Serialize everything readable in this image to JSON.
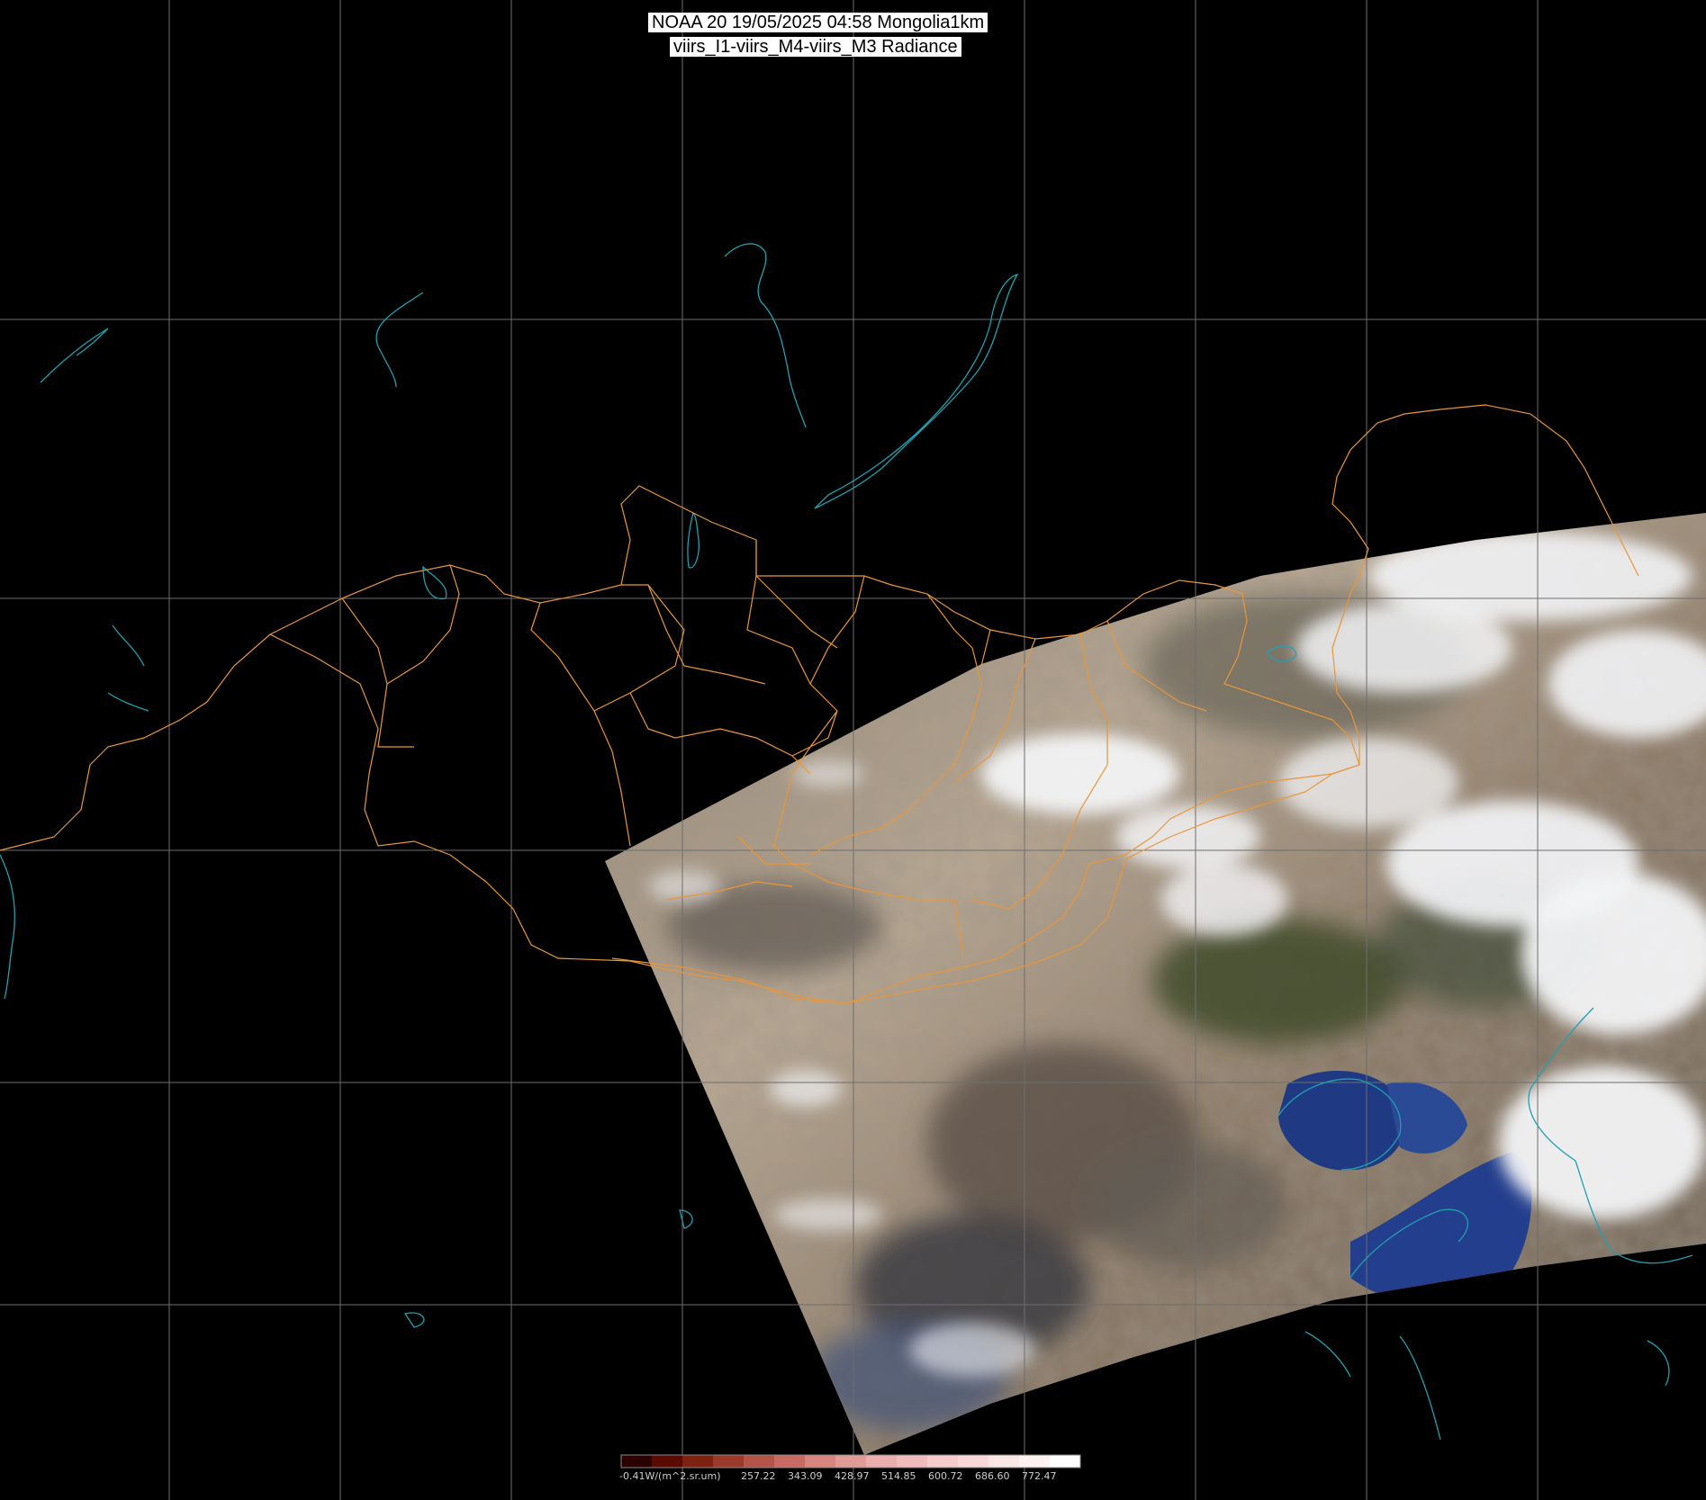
{
  "title": {
    "line1": "NOAA 20 19/05/2025 04:58 Mongolia1km",
    "line2": "viirs_I1-viirs_M4-viirs_M3 Radiance"
  },
  "colors": {
    "background": "#000000",
    "graticule": "#6e6e6e",
    "coastline": "#1fa0b0",
    "borders": "#e8963a",
    "desert": "#b8a893",
    "cloud": "#f2f3f6",
    "sea": "#1f3a82"
  },
  "colorbar": {
    "unit_label": "-0.41W/(m^2.sr.um)",
    "ticks": [
      "257.22",
      "343.09",
      "428.97",
      "514.85",
      "600.72",
      "686.60",
      "772.47"
    ],
    "colors": [
      "#2a0000",
      "#5a0a00",
      "#7d2210",
      "#9b3a2a",
      "#b45448",
      "#c86a63",
      "#d7857f",
      "#e29a96",
      "#eaaeac",
      "#f0bcbb",
      "#f5cccb",
      "#f8d8d8",
      "#fbe6e6",
      "#fdf1f1",
      "#ffffff"
    ]
  }
}
